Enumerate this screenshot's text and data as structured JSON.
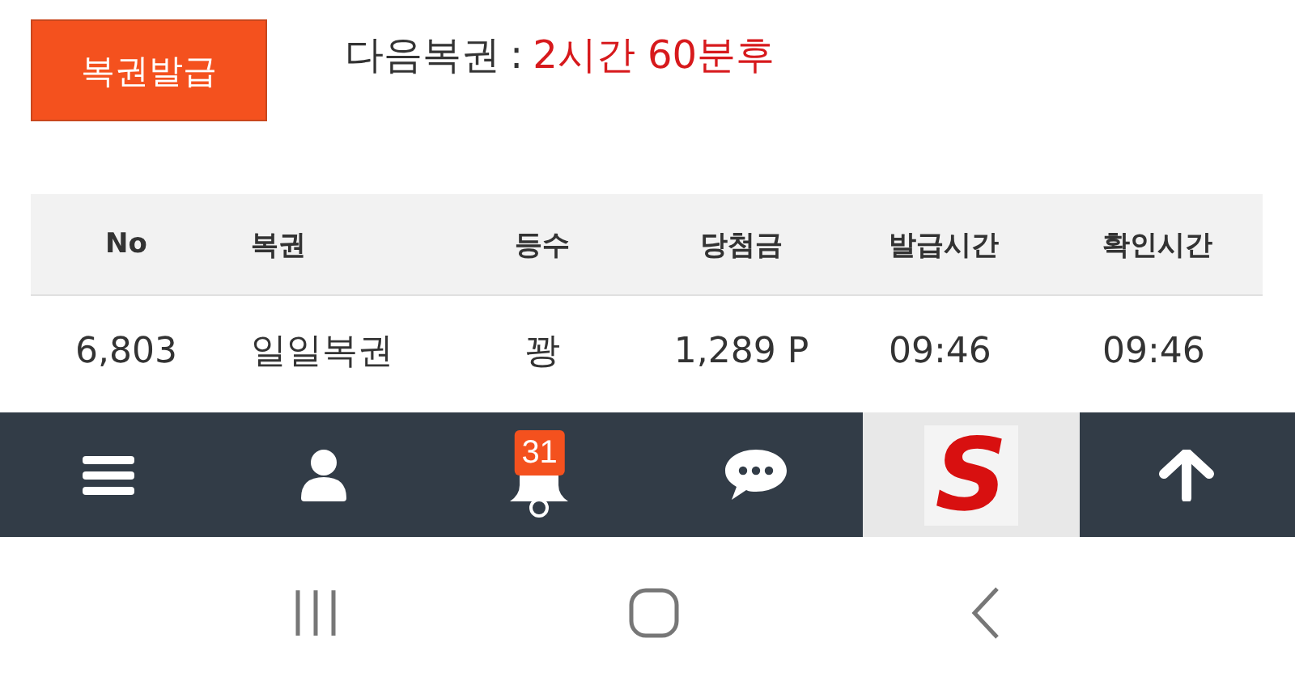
{
  "issue_button": {
    "label": "복권발급"
  },
  "next_lottery": {
    "label": "다음복권",
    "separator": ":",
    "remaining": "2시간 60분후"
  },
  "table": {
    "columns": [
      "No",
      "복권",
      "등수",
      "당첨금",
      "발급시간",
      "확인시간"
    ],
    "rows": [
      [
        "6,803",
        "일일복권",
        "꽝",
        "1,289 P",
        "09:46",
        "09:46"
      ]
    ]
  },
  "bottom_nav": [
    {
      "kind": "menu",
      "selected": false
    },
    {
      "kind": "user",
      "selected": false
    },
    {
      "kind": "bell",
      "selected": false,
      "badge": "31"
    },
    {
      "kind": "chat",
      "selected": false
    },
    {
      "kind": "logo",
      "selected": true,
      "text": "S"
    },
    {
      "kind": "top",
      "selected": false
    }
  ],
  "system_nav": [
    {
      "kind": "recents"
    },
    {
      "kind": "home"
    },
    {
      "kind": "back"
    }
  ]
}
